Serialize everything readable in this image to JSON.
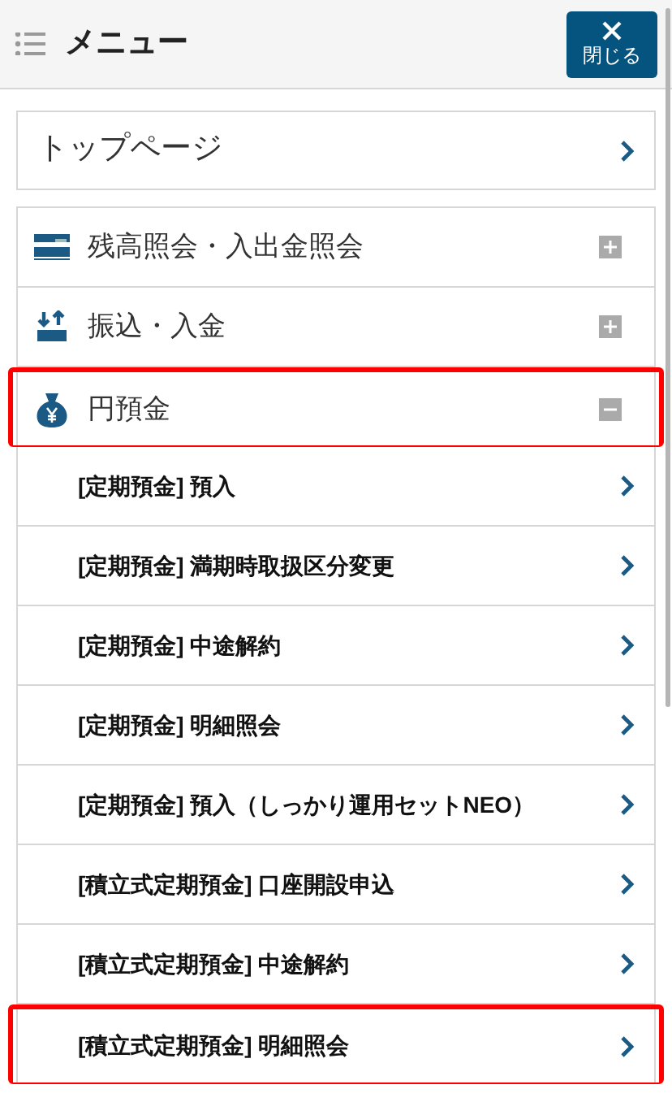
{
  "header": {
    "title": "メニュー",
    "close_button": "閉じる"
  },
  "top_link": {
    "label": "トップページ"
  },
  "sections": [
    {
      "label": "残高照会・入出金照会",
      "kind": "card",
      "expanded": false,
      "highlighted": false
    },
    {
      "label": "振込・入金",
      "kind": "transfer",
      "expanded": false,
      "highlighted": false
    },
    {
      "label": "円預金",
      "kind": "yen",
      "expanded": true,
      "highlighted": true,
      "children": [
        {
          "label": "[定期預金] 預入",
          "highlighted": false
        },
        {
          "label": "[定期預金] 満期時取扱区分変更",
          "highlighted": false
        },
        {
          "label": "[定期預金] 中途解約",
          "highlighted": false
        },
        {
          "label": "[定期預金] 明細照会",
          "highlighted": false
        },
        {
          "label": "[定期預金] 預入（しっかり運用セットNEO）",
          "highlighted": false
        },
        {
          "label": "[積立式定期預金] 口座開設申込",
          "highlighted": false
        },
        {
          "label": "[積立式定期預金] 中途解約",
          "highlighted": false
        },
        {
          "label": "[積立式定期預金] 明細照会",
          "highlighted": true
        }
      ]
    }
  ]
}
